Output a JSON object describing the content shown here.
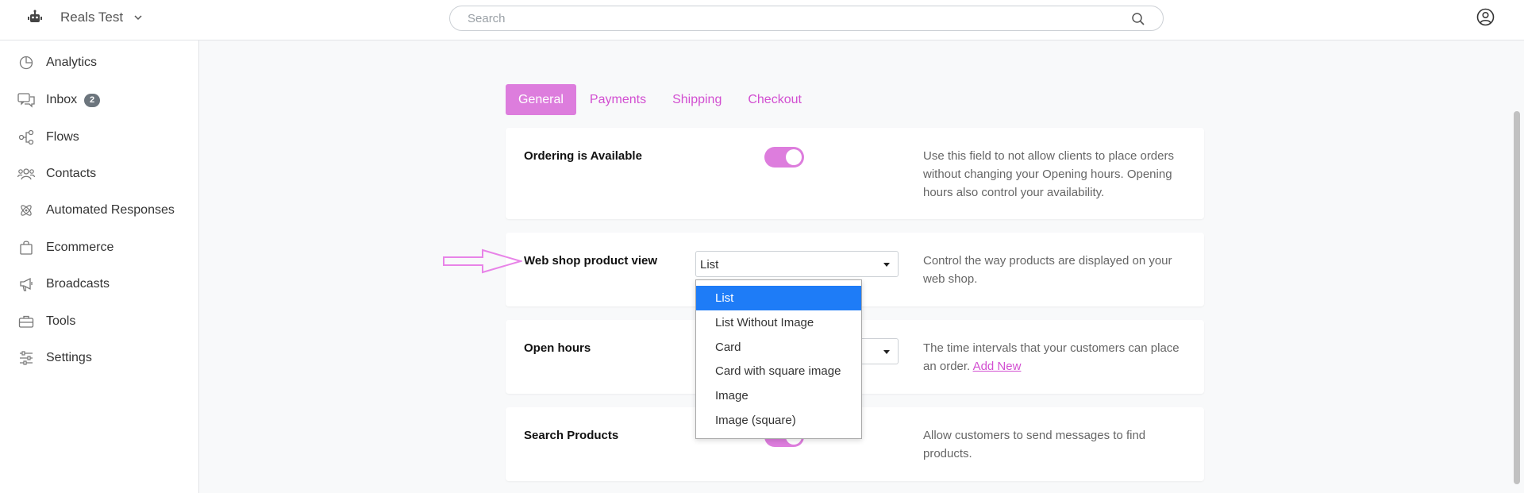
{
  "app": {
    "workspace_name": "Reals Test"
  },
  "search": {
    "placeholder": "Search"
  },
  "sidebar": {
    "items": [
      {
        "label": "Analytics",
        "icon": "analytics-icon"
      },
      {
        "label": "Inbox",
        "icon": "inbox-icon",
        "badge": "2"
      },
      {
        "label": "Flows",
        "icon": "flows-icon"
      },
      {
        "label": "Contacts",
        "icon": "contacts-icon"
      },
      {
        "label": "Automated Responses",
        "icon": "automated-responses-icon"
      },
      {
        "label": "Ecommerce",
        "icon": "ecommerce-icon"
      },
      {
        "label": "Broadcasts",
        "icon": "broadcasts-icon"
      },
      {
        "label": "Tools",
        "icon": "tools-icon"
      },
      {
        "label": "Settings",
        "icon": "settings-icon"
      }
    ]
  },
  "tabs": [
    {
      "label": "General",
      "active": true
    },
    {
      "label": "Payments",
      "active": false
    },
    {
      "label": "Shipping",
      "active": false
    },
    {
      "label": "Checkout",
      "active": false
    }
  ],
  "settings": {
    "ordering": {
      "title": "Ordering is Available",
      "enabled": true,
      "description": "Use this field to not allow clients to place orders without changing your Opening hours. Opening hours also control your availability."
    },
    "product_view": {
      "title": "Web shop product view",
      "selected": "List",
      "description": "Control the way products are displayed on your web shop.",
      "options": [
        "List",
        "List Without Image",
        "Card",
        "Card with square image",
        "Image",
        "Image (square)"
      ]
    },
    "open_hours": {
      "title": "Open hours",
      "description": "The time intervals that your customers can place an order.",
      "link": "Add New"
    },
    "search_products": {
      "title": "Search Products",
      "enabled": true,
      "description": "Allow customers to send messages to find products."
    }
  },
  "colors": {
    "accent": "#dd7ddd",
    "accent_text": "#d24fd1",
    "option_highlight": "#1e7cf7"
  }
}
